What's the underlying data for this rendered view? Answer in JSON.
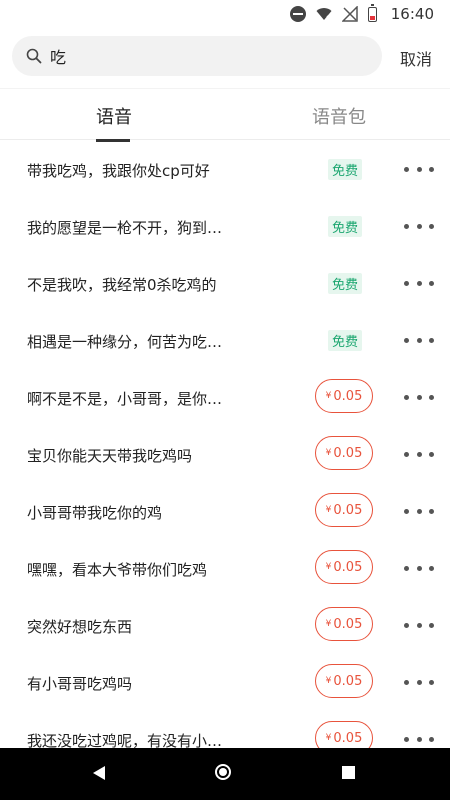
{
  "status_bar": {
    "time": "16:40"
  },
  "search": {
    "value": "吃",
    "placeholder": "",
    "cancel_label": "取消"
  },
  "tabs": [
    {
      "label": "语音",
      "active": true
    },
    {
      "label": "语音包",
      "active": false
    }
  ],
  "colors": {
    "free_text": "#1aa66f",
    "free_bg": "#e6f6ee",
    "price": "#e8533c"
  },
  "items": [
    {
      "title": "带我吃鸡，我跟你处cp可好",
      "badge": "免费"
    },
    {
      "title": "我的愿望是一枪不开，狗到…",
      "badge": "免费"
    },
    {
      "title": "不是我吹，我经常0杀吃鸡的",
      "badge": "免费"
    },
    {
      "title": "相遇是一种缘分，何苦为吃…",
      "badge": "免费"
    },
    {
      "title": "啊不是不是，小哥哥，是你…",
      "currency": "¥",
      "price": "0.05"
    },
    {
      "title": "宝贝你能天天带我吃鸡吗",
      "currency": "¥",
      "price": "0.05"
    },
    {
      "title": "小哥哥带我吃你的鸡",
      "currency": "¥",
      "price": "0.05"
    },
    {
      "title": "嘿嘿，看本大爷带你们吃鸡",
      "currency": "¥",
      "price": "0.05"
    },
    {
      "title": "突然好想吃东西",
      "currency": "¥",
      "price": "0.05"
    },
    {
      "title": "有小哥哥吃鸡吗",
      "currency": "¥",
      "price": "0.05"
    },
    {
      "title": "我还没吃过鸡呢，有没有小…",
      "currency": "¥",
      "price": "0.05"
    }
  ]
}
